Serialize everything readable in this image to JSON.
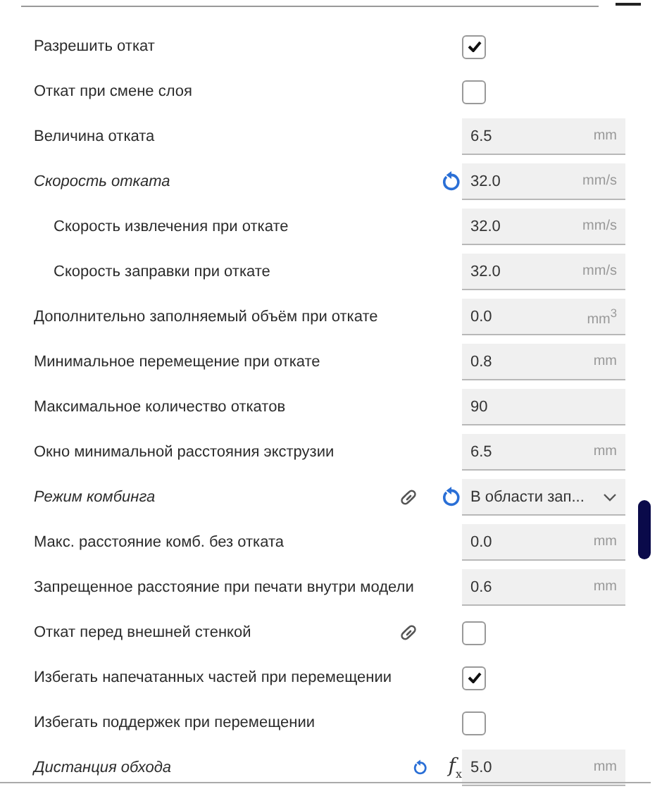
{
  "settings": [
    {
      "label": "Разрешить откат",
      "kind": "checkbox",
      "checked": true
    },
    {
      "label": "Откат при смене слоя",
      "kind": "checkbox",
      "checked": false
    },
    {
      "label": "Величина отката",
      "kind": "number",
      "value": "6.5",
      "unit": "mm"
    },
    {
      "label": "Скорость отката",
      "kind": "number",
      "value": "32.0",
      "unit": "mm/s",
      "modified": true,
      "reset": true,
      "children": [
        {
          "label": "Скорость извлечения при откате",
          "kind": "number",
          "value": "32.0",
          "unit": "mm/s"
        },
        {
          "label": "Скорость заправки при откате",
          "kind": "number",
          "value": "32.0",
          "unit": "mm/s"
        }
      ]
    },
    {
      "label": "Дополнительно заполняемый объём при откате",
      "kind": "number",
      "value": "0.0",
      "unit": "mm$^{3}$"
    },
    {
      "label": "Минимальное перемещение при откате",
      "kind": "number",
      "value": "0.8",
      "unit": "mm"
    },
    {
      "label": "Максимальное количество откатов",
      "kind": "number",
      "value": "90"
    },
    {
      "label": "Окно минимальной расстояния экструзии",
      "kind": "number",
      "value": "6.5",
      "unit": "mm"
    },
    {
      "label": "Режим комбинга",
      "kind": "dropdown",
      "value": "В области зап...",
      "modified": true,
      "linked": true,
      "reset": true
    },
    {
      "label": "Макс. расстояние комб. без отката",
      "kind": "number",
      "value": "0.0",
      "unit": "mm"
    },
    {
      "label": "Запрещенное расстояние при печати внутри модели",
      "kind": "number",
      "value": "0.6",
      "unit": "mm"
    },
    {
      "label": "Откат перед внешней стенкой",
      "kind": "checkbox",
      "checked": false,
      "linked": true
    },
    {
      "label": "Избегать напечатанных частей при перемещении",
      "kind": "checkbox",
      "checked": true
    },
    {
      "label": "Избегать поддержек при перемещении",
      "kind": "checkbox",
      "checked": false
    },
    {
      "label": "Дистанция обхода",
      "kind": "number",
      "value": "5.0",
      "unit": "mm",
      "modified": true,
      "reset": true,
      "formula": "*f*$_{x}$"
    }
  ]
}
